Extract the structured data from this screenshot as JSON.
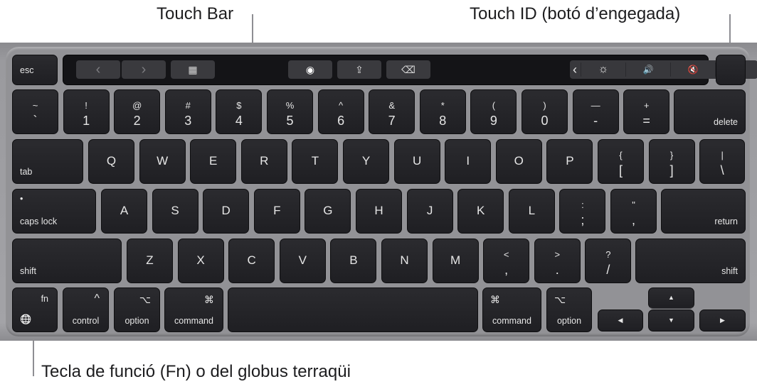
{
  "callouts": {
    "touch_bar": "Touch Bar",
    "touch_id": "Touch ID (botó d’engegada)",
    "fn_key": "Tecla de funció (Fn) o del globus terraqüi"
  },
  "touch_bar": {
    "esc": "esc",
    "buttons": [
      {
        "icon": "back-chevron-icon",
        "glyph": "‹"
      },
      {
        "icon": "forward-chevron-icon",
        "glyph": "›"
      },
      {
        "icon": "grid-icon",
        "glyph": "▦"
      },
      {
        "icon": "eye-icon",
        "glyph": "◉"
      },
      {
        "icon": "share-icon",
        "glyph": "⇪"
      },
      {
        "icon": "tag-icon",
        "glyph": "⌫"
      }
    ],
    "control_strip": [
      {
        "icon": "collapse-chevron-icon",
        "glyph": "‹"
      },
      {
        "icon": "brightness-icon",
        "glyph": "☼"
      },
      {
        "icon": "volume-icon",
        "glyph": "🔊"
      },
      {
        "icon": "mute-icon",
        "glyph": "🔇"
      },
      {
        "icon": "siri-icon",
        "glyph": ""
      }
    ]
  },
  "rows": {
    "number": [
      {
        "top": "~",
        "bot": "`"
      },
      {
        "top": "!",
        "bot": "1"
      },
      {
        "top": "@",
        "bot": "2"
      },
      {
        "top": "#",
        "bot": "3"
      },
      {
        "top": "$",
        "bot": "4"
      },
      {
        "top": "%",
        "bot": "5"
      },
      {
        "top": "^",
        "bot": "6"
      },
      {
        "top": "&",
        "bot": "7"
      },
      {
        "top": "*",
        "bot": "8"
      },
      {
        "top": "(",
        "bot": "9"
      },
      {
        "top": ")",
        "bot": "0"
      },
      {
        "top": "—",
        "bot": "-"
      },
      {
        "top": "+",
        "bot": "="
      }
    ],
    "delete": "delete",
    "tab": "tab",
    "qwerty": [
      "Q",
      "W",
      "E",
      "R",
      "T",
      "Y",
      "U",
      "I",
      "O",
      "P"
    ],
    "brackets": [
      {
        "top": "{",
        "bot": "["
      },
      {
        "top": "}",
        "bot": "]"
      },
      {
        "top": "|",
        "bot": "\\"
      }
    ],
    "caps_indicator": "•",
    "caps_lock": "caps lock",
    "home": [
      "A",
      "S",
      "D",
      "F",
      "G",
      "H",
      "J",
      "K",
      "L"
    ],
    "home_punct": [
      {
        "top": ":",
        "bot": ";"
      },
      {
        "top": "\"",
        "bot": ","
      }
    ],
    "return": "return",
    "shift_left": "shift",
    "bottom_letters": [
      "Z",
      "X",
      "C",
      "V",
      "B",
      "N",
      "M"
    ],
    "bottom_punct": [
      {
        "top": "<",
        "bot": ","
      },
      {
        "top": ">",
        "bot": "."
      },
      {
        "top": "?",
        "bot": "/"
      }
    ],
    "shift_right": "shift",
    "modifiers": {
      "fn": "fn",
      "globe_glyph": "🌐",
      "control": "control",
      "control_glyph": "^",
      "option": "option",
      "option_glyph": "⌥",
      "command": "command",
      "command_glyph": "⌘"
    },
    "arrows": {
      "up": "▲",
      "down": "▼",
      "left": "◀",
      "right": "▶"
    }
  }
}
